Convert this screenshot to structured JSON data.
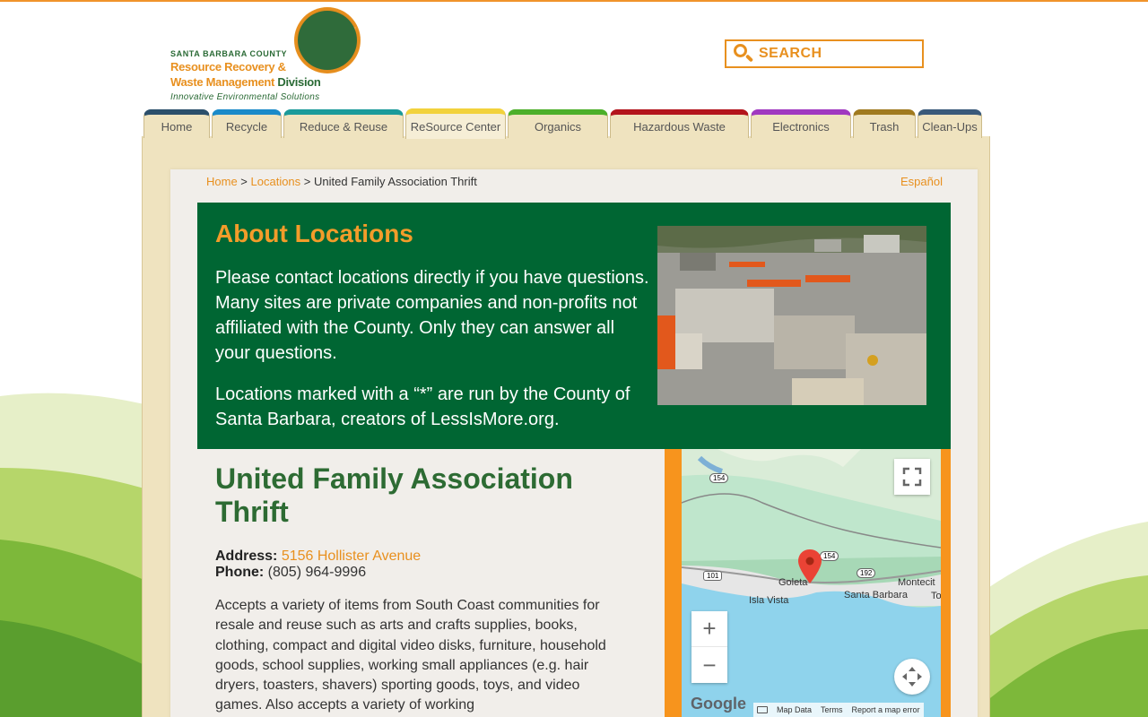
{
  "header": {
    "logo": {
      "county": "SANTA BARBARA COUNTY",
      "line1": "Resource Recovery &",
      "line2a": "Waste Management ",
      "line2b": "Division",
      "tagline": "Innovative Environmental Solutions",
      "badge_p": "p",
      "badge_w": "w"
    },
    "search_placeholder": "SEARCH"
  },
  "nav": {
    "tabs": [
      {
        "label": "Home",
        "color": "#2b4f6b",
        "width": 74
      },
      {
        "label": "Recycle",
        "color": "#1a8ac9",
        "width": 78
      },
      {
        "label": "Reduce & Reuse",
        "color": "#1a9a9a",
        "width": 134
      },
      {
        "label": "ReSource Center",
        "color": "#f2d23c",
        "width": 112
      },
      {
        "label": "Organics",
        "color": "#4caf2a",
        "width": 112
      },
      {
        "label": "Hazardous Waste",
        "color": "#b3141c",
        "width": 155
      },
      {
        "label": "Electronics",
        "color": "#a038c0",
        "width": 112
      },
      {
        "label": "Trash",
        "color": "#a07a1f",
        "width": 70
      },
      {
        "label": "Clean-Ups",
        "color": "#3a5a7a",
        "width": 72
      }
    ]
  },
  "breadcrumb": {
    "home": "Home",
    "sep1": " > ",
    "locations": "Locations",
    "sep2": " > ",
    "current": "United Family Association Thrift"
  },
  "language_link": "Español",
  "about": {
    "title": "About Locations",
    "p1": "Please contact locations directly if you have questions. Many sites are private companies and non-profits not affiliated with the County. Only they can answer all your questions.",
    "p2": "Locations marked with a “*” are run by the County of Santa Barbara, creators of LessIsMore.org."
  },
  "location": {
    "title": "United Family Association Thrift",
    "address_label": "Address:",
    "address": "5156 Hollister Avenue",
    "phone_label": "Phone:",
    "phone": "(805) 964-9996",
    "description": "Accepts a variety of items from South Coast communities for resale and reuse such as arts and crafts supplies, books, clothing, compact and digital video disks, furniture, household goods, school supplies, working small appliances (e.g. hair dryers, toasters, shavers) sporting goods, toys, and video games. Also accepts a variety of working"
  },
  "map": {
    "labels": {
      "goleta": "Goleta",
      "santa_barbara": "Santa Barbara",
      "isla_vista": "Isla Vista",
      "montecito": "Montecit",
      "r154a": "154",
      "r154b": "154",
      "r101": "101",
      "r192": "192",
      "to": "To"
    },
    "google": "Google",
    "footer": {
      "map_data": "Map Data",
      "terms": "Terms",
      "report": "Report a map error"
    },
    "zoom_in": "+",
    "zoom_out": "−"
  }
}
